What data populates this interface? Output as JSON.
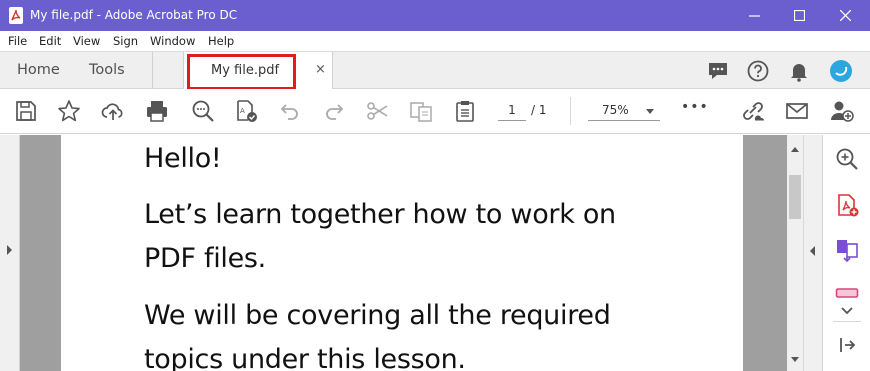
{
  "window": {
    "title": "My file.pdf - Adobe Acrobat Pro DC",
    "controls": [
      "minimize",
      "maximize",
      "close"
    ]
  },
  "menu": [
    "File",
    "Edit",
    "View",
    "Sign",
    "Window",
    "Help"
  ],
  "tabs": {
    "home": "Home",
    "tools": "Tools",
    "document": "My file.pdf",
    "close_symbol": "×"
  },
  "header_icons": [
    "comment-icon",
    "help-icon",
    "notification-bell-icon",
    "account-avatar"
  ],
  "toolbar": {
    "icons": [
      "save-icon",
      "bookmark-star-icon",
      "upload-cloud-icon",
      "print-icon",
      "find-icon",
      "edit-pdf-icon",
      "undo-icon",
      "redo-icon",
      "cut-icon",
      "copy-icon",
      "clipboard-icon"
    ],
    "page_current": "1",
    "page_total": "/  1",
    "zoom": "75%",
    "more": "•••",
    "right_icons": [
      "link-icon",
      "email-icon",
      "add-user-icon"
    ]
  },
  "document": {
    "lines": [
      "Hello!",
      "Let’s learn together how to work on",
      "PDF files.",
      "We will be covering all the required",
      "topics under this lesson."
    ]
  },
  "right_pane_icons": [
    "zoom-search-icon",
    "export-pdf-icon",
    "organize-pages-icon",
    "fill-sign-icon",
    "expand-chevron-icon",
    "collapse-pane-icon"
  ],
  "colors": {
    "titlebar": "#6b5fcf",
    "highlight_box": "#e31b1b",
    "avatar": "#2aa7df",
    "pdf_red": "#d83636",
    "organize_purple": "#7a4fd6",
    "fill_sign_pink": "#e0417c"
  }
}
